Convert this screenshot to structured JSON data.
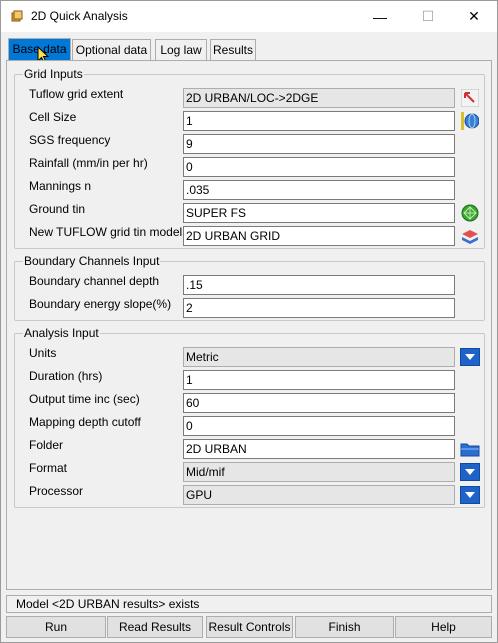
{
  "window": {
    "title": "2D Quick Analysis",
    "minimize": "—",
    "maximize": "☐",
    "close": "✕"
  },
  "tabs": [
    {
      "label": "Base data",
      "active": true
    },
    {
      "label": "Optional data",
      "active": false
    },
    {
      "label": "Log law",
      "active": false
    },
    {
      "label": "Results",
      "active": false
    }
  ],
  "grid_inputs": {
    "title": "Grid Inputs",
    "rows": [
      {
        "label": "Tuflow grid extent",
        "value": "2D URBAN/LOC->2DGE",
        "icon": "pick-arrow-icon"
      },
      {
        "label": "Cell Size",
        "value": "1",
        "icon": "globe-icon"
      },
      {
        "label": "SGS frequency",
        "value": "9"
      },
      {
        "label": "Rainfall (mm/in per hr)",
        "value": "0"
      },
      {
        "label": "Mannings n",
        "value": ".035"
      },
      {
        "label": "Ground tin",
        "value": "SUPER FS",
        "icon": "tin-icon"
      },
      {
        "label": "New TUFLOW grid tin model",
        "value": "2D URBAN GRID",
        "icon": "model-icon"
      }
    ]
  },
  "boundary": {
    "title": "Boundary Channels Input",
    "rows": [
      {
        "label": "Boundary channel depth",
        "value": ".15"
      },
      {
        "label": "Boundary energy slope(%)",
        "value": "2"
      }
    ]
  },
  "analysis": {
    "title": "Analysis Input",
    "rows": [
      {
        "label": "Units",
        "value": "Metric",
        "icon": "dropdown-icon"
      },
      {
        "label": "Duration (hrs)",
        "value": "1"
      },
      {
        "label": "Output time inc (sec)",
        "value": "60"
      },
      {
        "label": "Mapping depth cutoff",
        "value": "0"
      },
      {
        "label": "Folder",
        "value": "2D URBAN",
        "icon": "folder-icon"
      },
      {
        "label": "Format",
        "value": "Mid/mif",
        "icon": "dropdown-icon"
      },
      {
        "label": "Processor",
        "value": "GPU",
        "icon": "dropdown-icon"
      }
    ]
  },
  "status": {
    "message": "Model <2D URBAN results> exists"
  },
  "buttons": {
    "run": "Run",
    "read_results": "Read Results",
    "result_controls": "Result Controls",
    "finish": "Finish",
    "help": "Help"
  },
  "colors": {
    "accent": "#0078d7",
    "dropdown": "#1e64c8"
  }
}
